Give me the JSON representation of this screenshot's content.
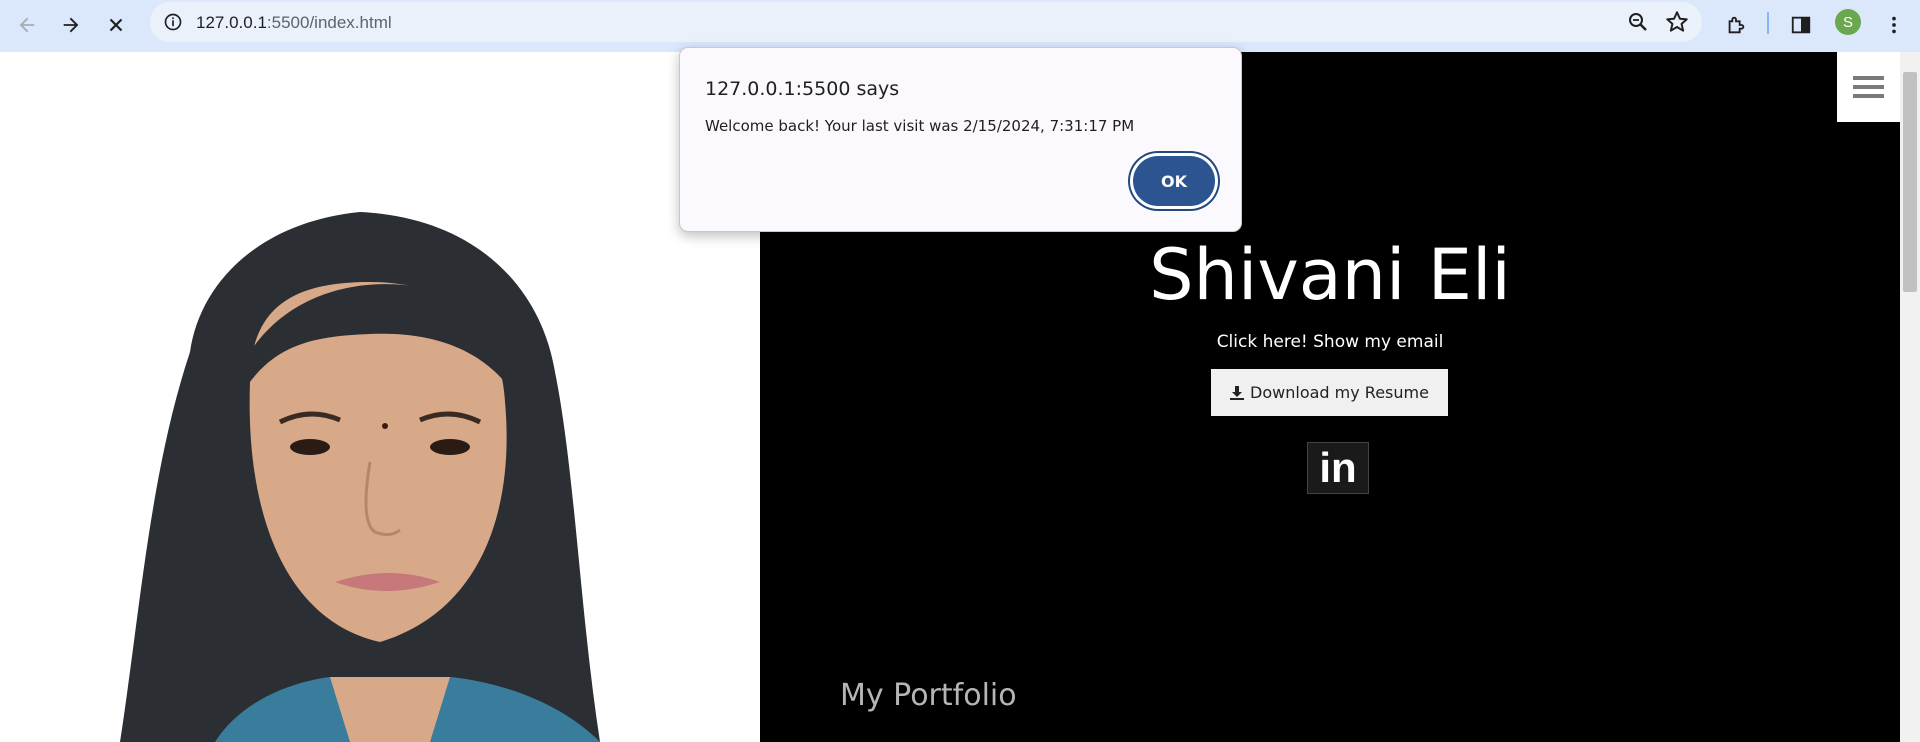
{
  "browser": {
    "url_host": "127.0.0.1",
    "url_rest": ":5500/index.html",
    "avatar_letter": "S",
    "icons": [
      "back-icon",
      "forward-icon",
      "stop-icon",
      "info-icon",
      "zoom-icon",
      "star-icon",
      "extensions-icon",
      "side-panel-icon",
      "more-icon"
    ]
  },
  "page": {
    "hero_title": "Shivani Eli",
    "email_link": "Click here! Show my email",
    "resume_button": "Download my Resume",
    "linkedin_label": "in",
    "portfolio_heading": "My Portfolio",
    "menu_icon": "hamburger-menu-icon"
  },
  "dialog": {
    "title": "127.0.0.1:5500 says",
    "message": "Welcome back! Your last visit was 2/15/2024, 7:31:17 PM",
    "ok_label": "OK"
  },
  "colors": {
    "toolbar": "#dbe7fb",
    "hero_bg": "#000000",
    "ok_button": "#2c5490"
  }
}
